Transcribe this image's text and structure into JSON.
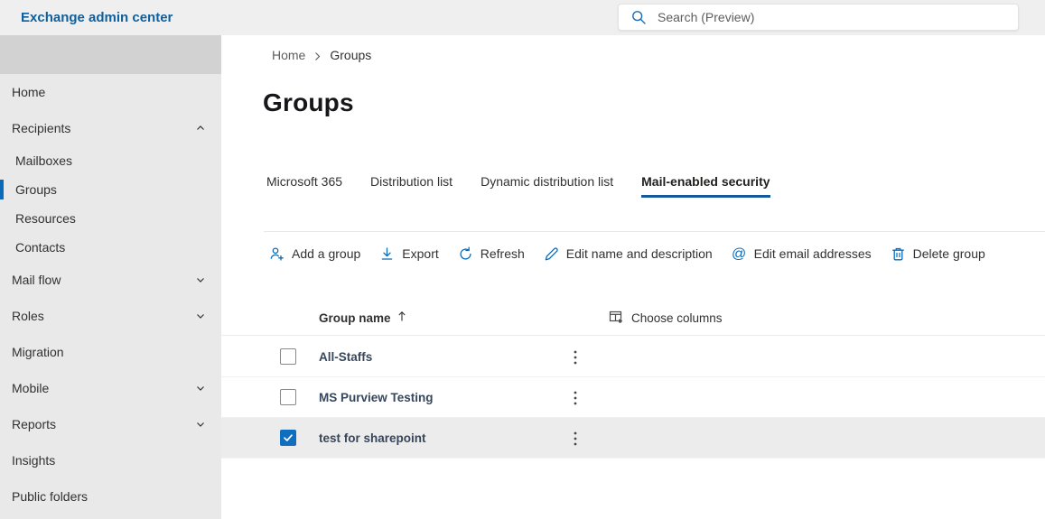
{
  "app": {
    "title": "Exchange admin center"
  },
  "search": {
    "placeholder": "Search (Preview)",
    "icon": "search-icon"
  },
  "sidebar": {
    "items": [
      {
        "label": "Home",
        "level": "top"
      },
      {
        "label": "Recipients",
        "level": "top",
        "chevron": "up",
        "expanded": true
      },
      {
        "label": "Mailboxes",
        "level": "sub"
      },
      {
        "label": "Groups",
        "level": "sub",
        "selected": true
      },
      {
        "label": "Resources",
        "level": "sub"
      },
      {
        "label": "Contacts",
        "level": "sub"
      },
      {
        "label": "Mail flow",
        "level": "top",
        "chevron": "down"
      },
      {
        "label": "Roles",
        "level": "top",
        "chevron": "down"
      },
      {
        "label": "Migration",
        "level": "top"
      },
      {
        "label": "Mobile",
        "level": "top",
        "chevron": "down"
      },
      {
        "label": "Reports",
        "level": "top",
        "chevron": "down"
      },
      {
        "label": "Insights",
        "level": "top"
      },
      {
        "label": "Public folders",
        "level": "top"
      }
    ]
  },
  "breadcrumb": {
    "home": "Home",
    "current": "Groups"
  },
  "page": {
    "title": "Groups"
  },
  "tabs": {
    "items": [
      {
        "label": "Microsoft 365",
        "active": false
      },
      {
        "label": "Distribution list",
        "active": false
      },
      {
        "label": "Dynamic distribution list",
        "active": false
      },
      {
        "label": "Mail-enabled security",
        "active": true
      }
    ]
  },
  "toolbar": {
    "items": [
      {
        "label": "Add a group",
        "icon": "person-add-icon"
      },
      {
        "label": "Export",
        "icon": "download-icon"
      },
      {
        "label": "Refresh",
        "icon": "refresh-icon"
      },
      {
        "label": "Edit name and description",
        "icon": "pencil-icon"
      },
      {
        "label": "Edit email addresses",
        "icon": "at-icon",
        "glyph": "@"
      },
      {
        "label": "Delete group",
        "icon": "trash-icon"
      }
    ]
  },
  "table": {
    "name_column": "Group name",
    "sort": "ascending",
    "choose_columns_label": "Choose columns",
    "rows": [
      {
        "name": "All-Staffs",
        "checked": false,
        "selected": false
      },
      {
        "name": "MS Purview Testing",
        "checked": false,
        "selected": false
      },
      {
        "name": "test for sharepoint",
        "checked": true,
        "selected": true
      }
    ]
  },
  "colors": {
    "accent_blue": "#0a6bb8",
    "checkbox_checked": "#106ebe",
    "tab_underline": "#15599b",
    "app_title_blue": "#0d5f9e",
    "topbar_bg": "#efefef",
    "sidebar_bg": "#e9e9e9",
    "sidebar_block_bg": "#d2d2d2",
    "selected_row_bg": "#ececec"
  }
}
